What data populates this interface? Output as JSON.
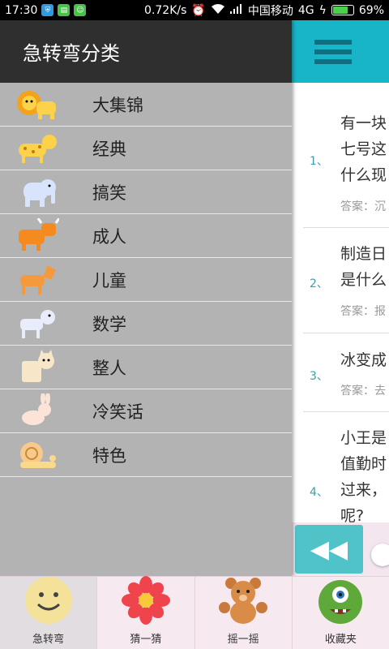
{
  "status_bar": {
    "time": "17:30",
    "net_speed": "0.72K/s",
    "carrier": "中国移动",
    "network": "4G",
    "battery": "69%",
    "battery_level": 0.69
  },
  "drawer": {
    "title": "急转弯分类",
    "categories": [
      {
        "label": "大集锦",
        "icon": "lion-icon"
      },
      {
        "label": "经典",
        "icon": "leopard-icon"
      },
      {
        "label": "搞笑",
        "icon": "elephant-icon"
      },
      {
        "label": "成人",
        "icon": "bull-icon"
      },
      {
        "label": "儿童",
        "icon": "horse-icon"
      },
      {
        "label": "数学",
        "icon": "dog-icon"
      },
      {
        "label": "整人",
        "icon": "cat-icon"
      },
      {
        "label": "冷笑话",
        "icon": "rabbit-icon"
      },
      {
        "label": "特色",
        "icon": "snail-icon"
      }
    ]
  },
  "content": {
    "questions": [
      {
        "num": "1、",
        "lines": [
          "有一块",
          "七号这",
          "什么现"
        ],
        "answer": "答案：沉"
      },
      {
        "num": "2、",
        "lines": [
          "制造日",
          "是什么"
        ],
        "answer": "答案：报"
      },
      {
        "num": "3、",
        "lines": [
          "冰变成"
        ],
        "answer": "答案：去"
      },
      {
        "num": "4、",
        "lines": [
          "小王是",
          "值勤时",
          "过来，",
          "呢?"
        ],
        "answer": ""
      }
    ]
  },
  "tabs": [
    {
      "label": "急转弯",
      "icon": "smiley-icon",
      "active": true
    },
    {
      "label": "猜一猜",
      "icon": "flower-icon",
      "active": false
    },
    {
      "label": "摇一摇",
      "icon": "teddy-bear-icon",
      "active": false
    },
    {
      "label": "收藏夹",
      "icon": "monster-icon",
      "active": false
    }
  ],
  "colors": {
    "accent": "#18b5c8",
    "drawer_bg": "#b3b3b3",
    "drawer_header": "#2f2f2f"
  }
}
